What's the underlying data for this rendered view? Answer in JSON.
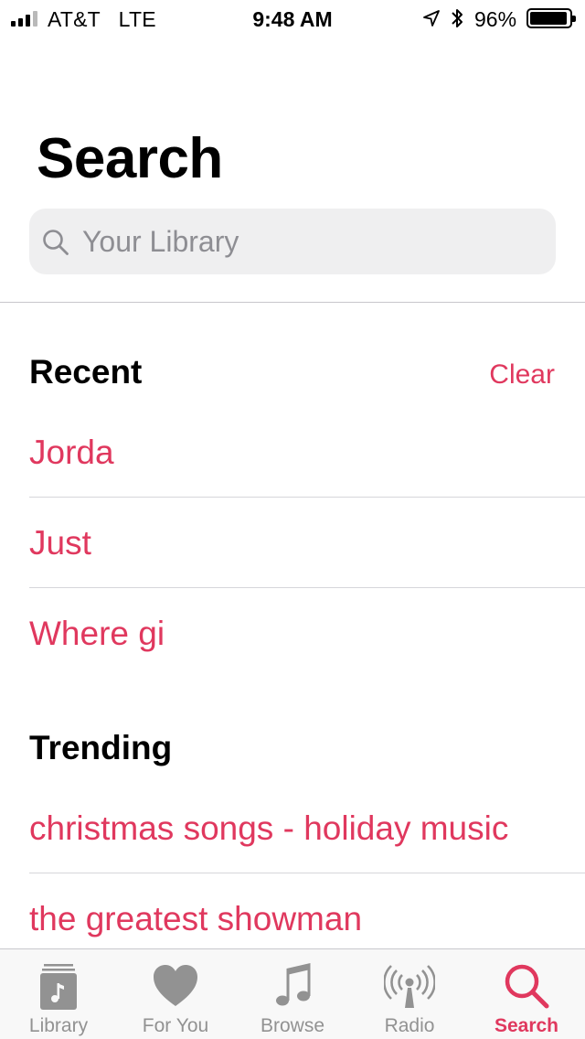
{
  "status_bar": {
    "carrier": "AT&T",
    "network": "LTE",
    "time": "9:48 AM",
    "battery_percent": "96%",
    "battery_level": 0.96,
    "signal_bars": 3
  },
  "header": {
    "title": "Search",
    "search_placeholder": "Your Library",
    "search_value": ""
  },
  "recent": {
    "title": "Recent",
    "clear_label": "Clear",
    "items": [
      "Jorda",
      "Just",
      "Where gi"
    ]
  },
  "trending": {
    "title": "Trending",
    "items": [
      "christmas songs - holiday music",
      "the greatest showman"
    ]
  },
  "tab_bar": {
    "tabs": [
      {
        "label": "Library",
        "icon": "library-icon",
        "active": false
      },
      {
        "label": "For You",
        "icon": "heart-icon",
        "active": false
      },
      {
        "label": "Browse",
        "icon": "music-note-icon",
        "active": false
      },
      {
        "label": "Radio",
        "icon": "radio-icon",
        "active": false
      },
      {
        "label": "Search",
        "icon": "search-icon",
        "active": true
      }
    ]
  },
  "colors": {
    "accent": "#e0385e",
    "inactive_tab": "#929292",
    "search_field_bg": "#efeff0"
  }
}
